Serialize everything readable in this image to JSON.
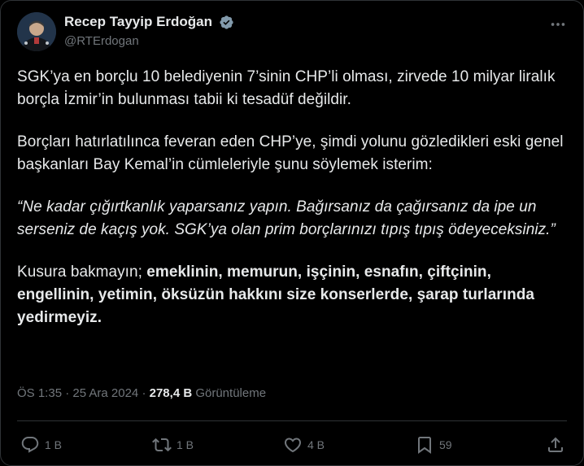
{
  "author": {
    "display_name": "Recep Tayyip Erdoğan",
    "handle": "@RTErdogan"
  },
  "post": {
    "paragraphs": {
      "p1": "SGK’ya en borçlu 10 belediyenin 7’sinin CHP’li olması, zirvede 10 milyar liralık borçla İzmir’in bulunması tabii ki tesadüf değildir.",
      "p2": "Borçları hatırlatılınca feveran eden CHP’ye, şimdi yolunu gözledikleri eski genel başkanları Bay Kemal’in cümleleriyle şunu söylemek isterim:",
      "quote": "“Ne kadar çığırtkanlık yaparsanız yapın. Bağırsanız da çağırsanız da ipe un serseniz de kaçış yok. SGK’ya olan prim borçlarınızı tıpış tıpış ödeyeceksiniz.”",
      "p4_lead": "Kusura bakmayın; ",
      "p4_bold": "emeklinin, memurun, işçinin, esnafın, çiftçinin, engellinin, yetimin, öksüzün hakkını size konserlerde, şarap turlarında yedirmeyiz."
    },
    "timestamp": "ÖS 1:35 · 25 Ara 2024",
    "separator": " · ",
    "views_count": "278,4 B",
    "views_label": " Görüntüleme"
  },
  "actions": {
    "reply_count": "1 B",
    "repost_count": "1 B",
    "like_count": "4 B",
    "bookmark_count": "59"
  },
  "colors": {
    "background": "#000000",
    "text": "#e7e9ea",
    "muted": "#71767b",
    "verified": "#829aab"
  }
}
